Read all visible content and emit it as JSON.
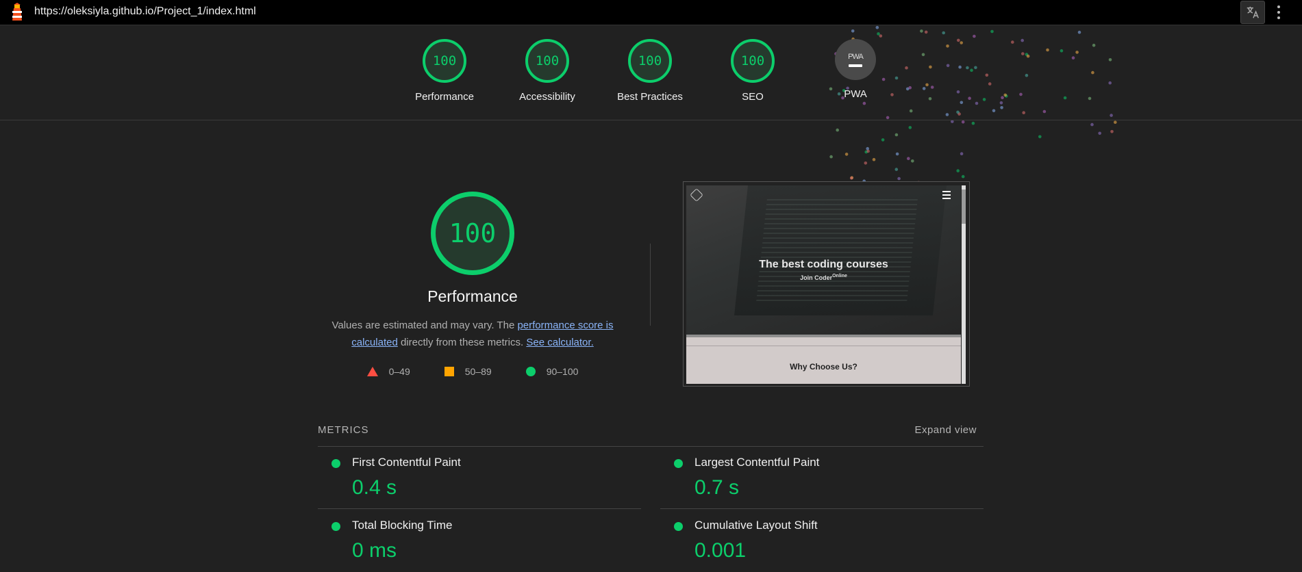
{
  "browser": {
    "url": "https://oleksiyla.github.io/Project_1/index.html",
    "logo_icon": "lighthouse-icon",
    "translate_icon": "translate-icon",
    "menu_icon": "kebab-menu-icon"
  },
  "summary": {
    "gauges": [
      {
        "label": "Performance",
        "score": "100"
      },
      {
        "label": "Accessibility",
        "score": "100"
      },
      {
        "label": "Best Practices",
        "score": "100"
      },
      {
        "label": "SEO",
        "score": "100"
      },
      {
        "label": "PWA",
        "score": "PWA"
      }
    ]
  },
  "performance": {
    "score": "100",
    "title": "Performance",
    "desc_prefix": "Values are estimated and may vary. The ",
    "desc_link1": "performance score is calculated",
    "desc_middle": " directly from these metrics. ",
    "desc_link2": "See calculator.",
    "legend": [
      {
        "range": "0–49",
        "color": "#ff4e42"
      },
      {
        "range": "50–89",
        "color": "#ffa400"
      },
      {
        "range": "90–100",
        "color": "#0cce6b"
      }
    ]
  },
  "preview": {
    "hero_title": "The best coding courses",
    "hero_sub": "Join Coder",
    "hero_sup": "Online",
    "section_title": "Why Choose Us?"
  },
  "metrics": {
    "header": "METRICS",
    "expand": "Expand view",
    "items": [
      {
        "name": "First Contentful Paint",
        "value": "0.4 s"
      },
      {
        "name": "Largest Contentful Paint",
        "value": "0.7 s"
      },
      {
        "name": "Total Blocking Time",
        "value": "0 ms"
      },
      {
        "name": "Cumulative Layout Shift",
        "value": "0.001"
      }
    ]
  },
  "colors": {
    "pass": "#0cce6b",
    "average": "#ffa400",
    "fail": "#ff4e42",
    "background": "#212121"
  }
}
